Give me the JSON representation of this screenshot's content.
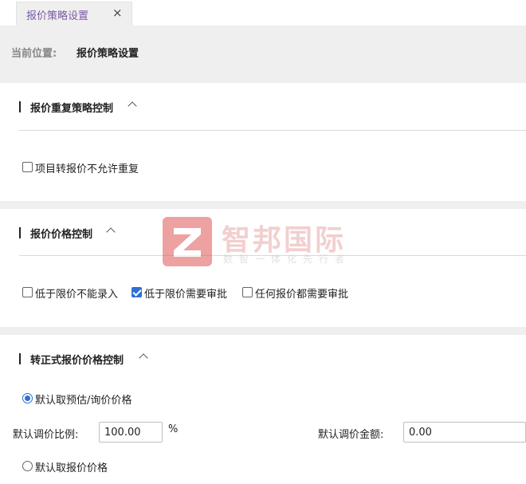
{
  "tabs": [
    {
      "label": "报价策略设置",
      "close": "×"
    }
  ],
  "breadcrumb": {
    "label": "当前位置:",
    "value": "报价策略设置"
  },
  "sections": {
    "repeat": {
      "title": "报价重复策略控制",
      "options": [
        {
          "label": "项目转报价不允许重复",
          "checked": false
        }
      ]
    },
    "price": {
      "title": "报价价格控制",
      "options": [
        {
          "label": "低于限价不能录入",
          "checked": false
        },
        {
          "label": "低于限价需要审批",
          "checked": true
        },
        {
          "label": "任何报价都需要审批",
          "checked": false
        }
      ]
    },
    "formal": {
      "title": "转正式报价价格控制",
      "radio_estimate": {
        "label": "默认取预估/询价价格",
        "selected": true
      },
      "ratio_label": "默认调价比例:",
      "ratio_value": "100.00",
      "ratio_unit": "%",
      "amount_label": "默认调价金额:",
      "amount_value": "0.00",
      "radio_quote": {
        "label": "默认取报价价格",
        "selected": false
      }
    }
  },
  "watermark": {
    "text": "智邦国际",
    "sub": "数智一体化先行者",
    "color": "#e05555"
  },
  "colors": {
    "accent": "#2f6fd6",
    "tab_text": "#7b5aa8",
    "gap": "#efefef"
  }
}
